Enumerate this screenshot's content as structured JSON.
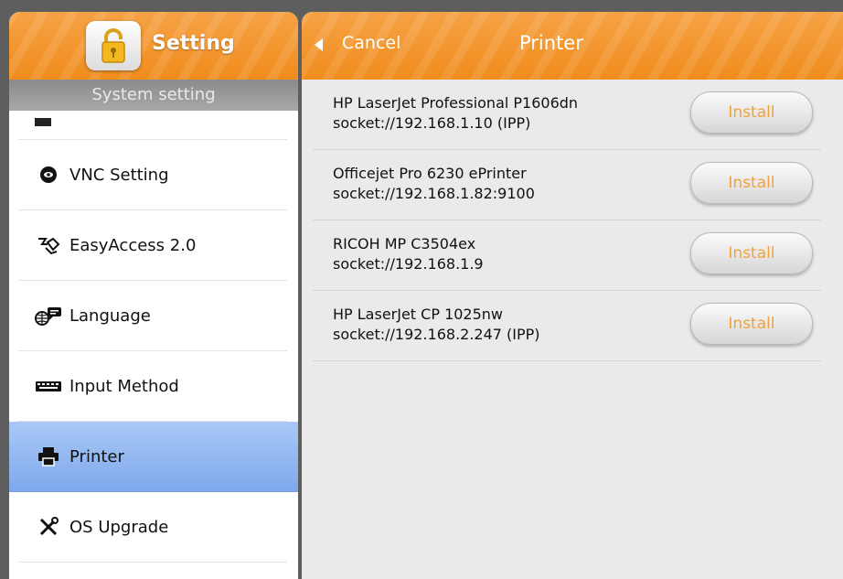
{
  "left_panel": {
    "title": "Setting",
    "subheader": "System setting",
    "menu": [
      {
        "label": "VNC Setting",
        "icon": "eye-icon"
      },
      {
        "label": "EasyAccess 2.0",
        "icon": "easyaccess-icon"
      },
      {
        "label": "Language",
        "icon": "globe-chat-icon"
      },
      {
        "label": "Input Method",
        "icon": "keyboard-icon"
      },
      {
        "label": "Printer",
        "icon": "printer-icon",
        "active": true
      },
      {
        "label": "OS Upgrade",
        "icon": "tools-icon"
      }
    ]
  },
  "right_panel": {
    "back_label": "Cancel",
    "title": "Printer",
    "printers": [
      {
        "name": "HP LaserJet Professional P1606dn",
        "uri": "socket://192.168.1.10 (IPP)",
        "action": "Install"
      },
      {
        "name": "Officejet Pro 6230 ePrinter",
        "uri": "socket://192.168.1.82:9100",
        "action": "Install"
      },
      {
        "name": "RICOH MP C3504ex",
        "uri": "socket://192.168.1.9",
        "action": "Install"
      },
      {
        "name": "HP LaserJet CP 1025nw",
        "uri": "socket://192.168.2.247 (IPP)",
        "action": "Install"
      }
    ]
  },
  "colors": {
    "header_orange": "#f08c1c",
    "active_blue": "#7fa9ec",
    "install_text": "#f2a23a"
  }
}
